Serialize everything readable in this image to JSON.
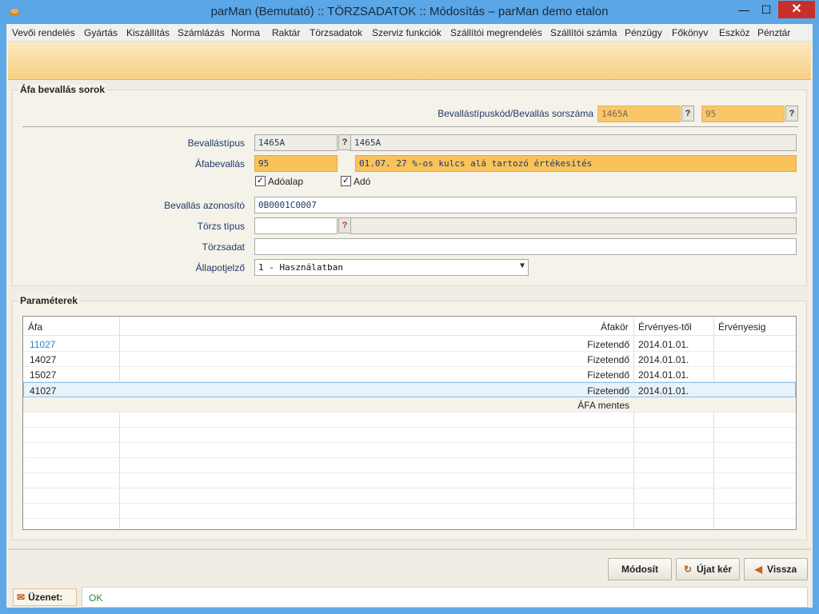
{
  "window": {
    "title": "parMan (Bemutató) :: TÖRZSADATOK :: Módosítás   –   parMan demo etalon",
    "min_label": "—",
    "max_label": "☐",
    "close_label": "✕"
  },
  "menu": [
    "Vevői rendelés",
    "Gyártás",
    "Kiszállítás",
    "Számlázás",
    "Norma",
    "Raktár",
    "Törzsadatok",
    "Szerviz funkciók",
    "Szállítói megrendelés",
    "Szállítói számla",
    "Pénzügy",
    "Főkönyv",
    "Eszköz",
    "Pénztár"
  ],
  "section1": {
    "title": "Áfa bevallás sorok",
    "code_label": "Bevallástípuskód/Bevallás sorszáma",
    "code_value": "1465A",
    "serial_value": "95",
    "type_label": "Bevallástípus",
    "type_value": "1465A",
    "type_desc": "1465A",
    "afa_label": "Áfabevallás",
    "afa_value": "95",
    "afa_desc": "01.07. 27 %-os kulcs alá tartozó értékesítés",
    "chk_base_label": "Adóalap",
    "chk_tax_label": "Adó",
    "id_label": "Bevallás azonosító",
    "id_value": "0B0001C0007",
    "master_type_label": "Törzs típus",
    "master_type_value": "",
    "master_data_label": "Törzsadat",
    "master_data_value": "",
    "status_label": "Állapotjelző",
    "status_value": "1 - Használatban",
    "q": "?"
  },
  "section2": {
    "title": "Paraméterek",
    "columns": [
      "Áfa",
      "Áfakör",
      "Érvényes-től",
      "Érvényesig"
    ],
    "rows": [
      {
        "afa": "11027",
        "afakor": "Fizetendő",
        "from": "2014.01.01.",
        "to": ""
      },
      {
        "afa": "14027",
        "afakor": "Fizetendő",
        "from": "2014.01.01.",
        "to": ""
      },
      {
        "afa": "15027",
        "afakor": "Fizetendő",
        "from": "2014.01.01.",
        "to": ""
      },
      {
        "afa": "41027",
        "afakor": "Fizetendő",
        "from": "2014.01.01.",
        "to": ""
      },
      {
        "afa": "",
        "afakor": "ÁFA mentes",
        "from": "",
        "to": ""
      }
    ]
  },
  "buttons": {
    "modify": "Módosít",
    "new": "Újat kér",
    "back": "Vissza"
  },
  "message": {
    "label": "Üzenet:",
    "value": "OK"
  },
  "colors": {
    "title_bar": "#5aa6e6",
    "accent_orange": "#f9c25b",
    "close_red": "#c7302a",
    "link_blue": "#2f7fc1",
    "ok_green": "#2e8b2e"
  }
}
